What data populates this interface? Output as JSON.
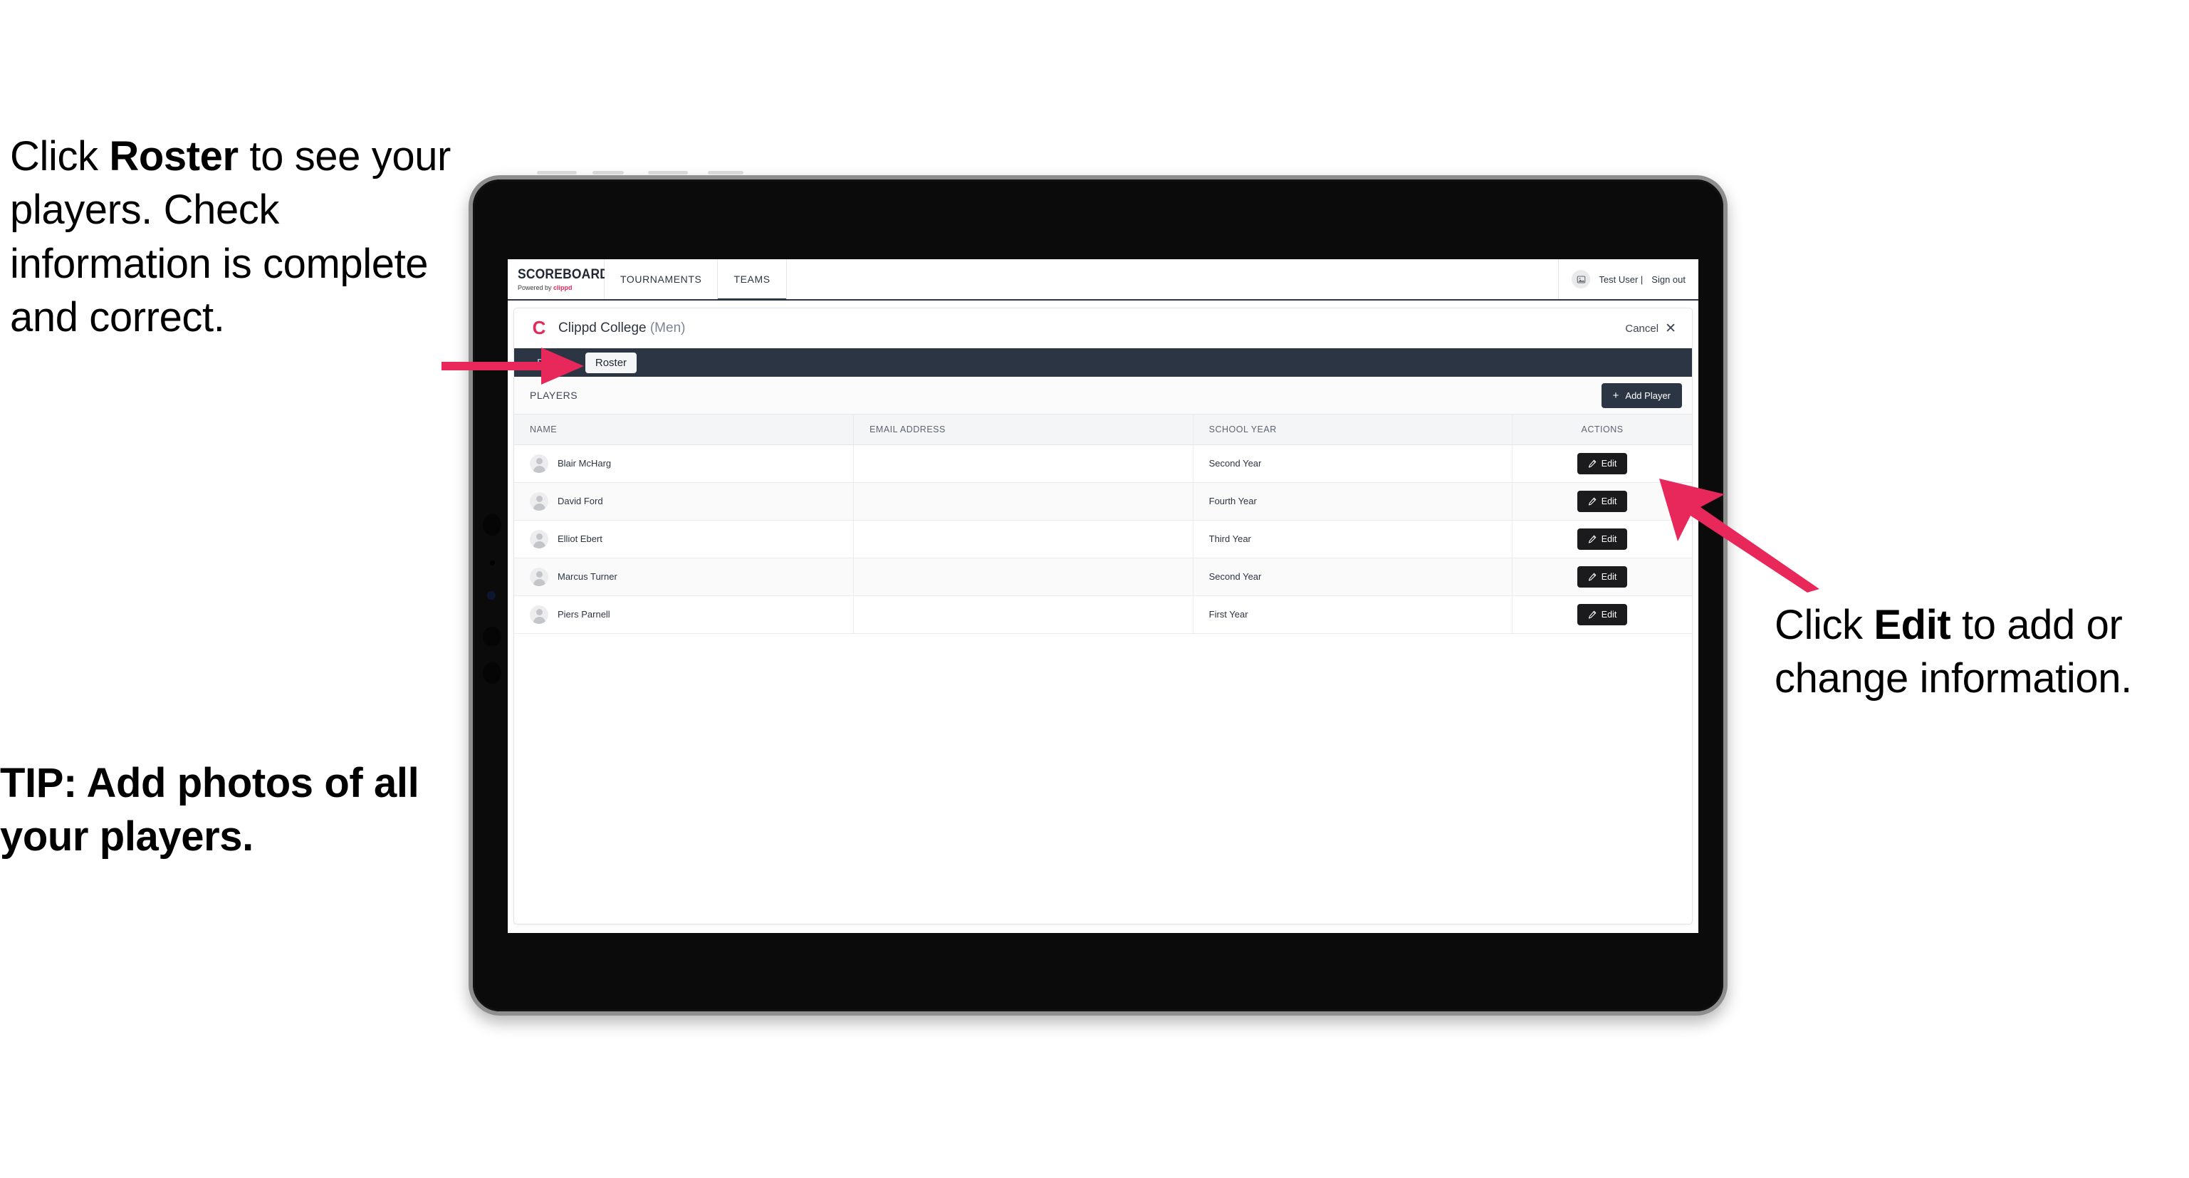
{
  "annotations": {
    "left": {
      "line1_pre": "Click ",
      "line1_bold": "Roster",
      "line1_post": " to see your players. Check information is complete and correct."
    },
    "tip": "TIP: Add photos of all your players.",
    "right": {
      "line1_pre": "Click ",
      "line1_bold": "Edit",
      "line1_post": " to add or change information."
    },
    "arrow_color": "#e8275b"
  },
  "device": {
    "type": "tablet",
    "bezel_color": "#0b0b0b",
    "frame_color": "#8e8e8e"
  },
  "app": {
    "topnav": {
      "brand_title": "SCOREBOARD",
      "brand_sub_prefix": "Powered by ",
      "brand_sub_mark": "clippd",
      "tabs": [
        {
          "label": "TOURNAMENTS",
          "active": false
        },
        {
          "label": "TEAMS",
          "active": true
        }
      ],
      "avatar_icon": "user-image-icon",
      "user_name": "Test User |",
      "signout_label": "Sign out"
    },
    "card": {
      "team_logo_letter": "C",
      "team_name": "Clippd College",
      "team_gender": "(Men)",
      "cancel_label": "Cancel",
      "cancel_icon": "close-icon",
      "subtabs": [
        {
          "label": "Details",
          "active": false
        },
        {
          "label": "Roster",
          "active": true
        }
      ],
      "players_section_label": "PLAYERS",
      "add_player": {
        "plus": "+",
        "label": "Add Player"
      },
      "table": {
        "columns": [
          "NAME",
          "EMAIL ADDRESS",
          "SCHOOL YEAR",
          "ACTIONS"
        ],
        "edit_label": "Edit",
        "edit_icon": "pencil-icon",
        "rows": [
          {
            "name": "Blair McHarg",
            "email": "",
            "school_year": "Second Year"
          },
          {
            "name": "David Ford",
            "email": "",
            "school_year": "Fourth Year"
          },
          {
            "name": "Elliot Ebert",
            "email": "",
            "school_year": "Third Year"
          },
          {
            "name": "Marcus Turner",
            "email": "",
            "school_year": "Second Year"
          },
          {
            "name": "Piers Parnell",
            "email": "",
            "school_year": "First Year"
          }
        ]
      }
    }
  },
  "colors": {
    "accent_pink": "#e8275b",
    "navy": "#2b3544",
    "button_black": "#1b1b1d"
  }
}
